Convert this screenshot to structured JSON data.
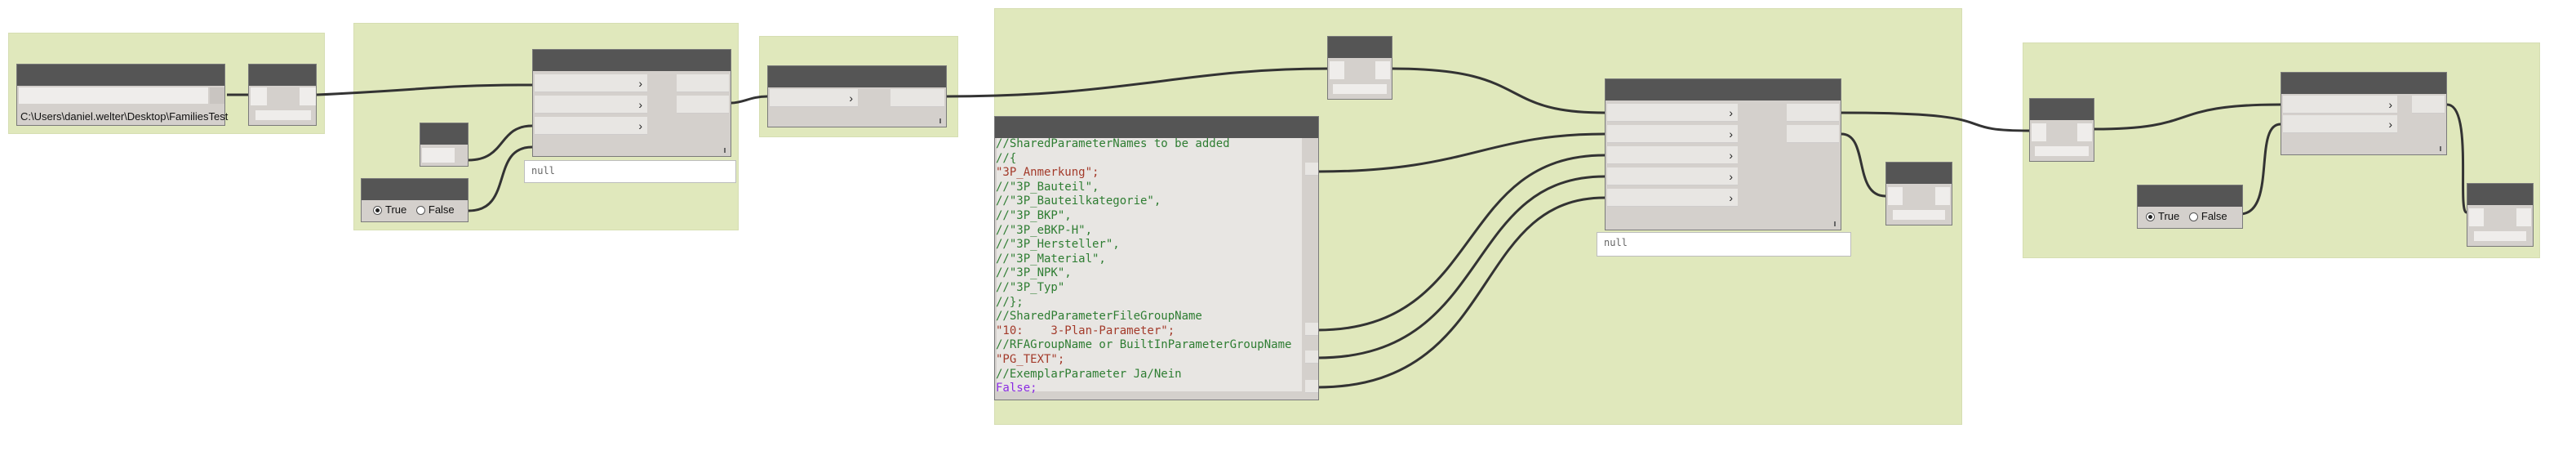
{
  "colors": {
    "canvas": "#ffffff",
    "group": "#e0e8bc",
    "node_header": "#555555",
    "node_body": "#d4d0cc",
    "wire": "#333333",
    "comment": "#2e7d32",
    "string": "#a33a2a",
    "keyword": "#8a2be2"
  },
  "path_input": {
    "value": "C:\\Users\\daniel.welter\\Desktop\\FamiliesTest"
  },
  "boolean_toggles": [
    {
      "true_label": "True",
      "false_label": "False",
      "selected": "True"
    },
    {
      "true_label": "True",
      "false_label": "False",
      "selected": "True"
    }
  ],
  "watch_previews": [
    {
      "value": "null"
    },
    {
      "value": "null"
    }
  ],
  "code_block": {
    "lines": [
      {
        "text": "//SharedParameterNames to be added",
        "kind": "comment"
      },
      {
        "text": "//{",
        "kind": "comment"
      },
      {
        "text": "\"3P_Anmerkung\";",
        "kind": "string"
      },
      {
        "text": "//\"3P_Bauteil\",",
        "kind": "comment"
      },
      {
        "text": "//\"3P_Bauteilkategorie\",",
        "kind": "comment"
      },
      {
        "text": "//\"3P_BKP\",",
        "kind": "comment"
      },
      {
        "text": "//\"3P_eBKP-H\",",
        "kind": "comment"
      },
      {
        "text": "//\"3P_Hersteller\",",
        "kind": "comment"
      },
      {
        "text": "//\"3P_Material\",",
        "kind": "comment"
      },
      {
        "text": "//\"3P_NPK\",",
        "kind": "comment"
      },
      {
        "text": "//\"3P_Typ\"",
        "kind": "comment"
      },
      {
        "text": "//};",
        "kind": "comment"
      },
      {
        "text": "//SharedParameterFileGroupName",
        "kind": "comment"
      },
      {
        "text": "\"10:    3-Plan-Parameter\";",
        "kind": "string"
      },
      {
        "text": "//RFAGroupName or BuiltInParameterGroupName",
        "kind": "comment"
      },
      {
        "text": "\"PG_TEXT\";",
        "kind": "string"
      },
      {
        "text": "//ExemplarParameter Ja/Nein",
        "kind": "comment"
      },
      {
        "text": "False;",
        "kind": "keyword"
      }
    ]
  }
}
